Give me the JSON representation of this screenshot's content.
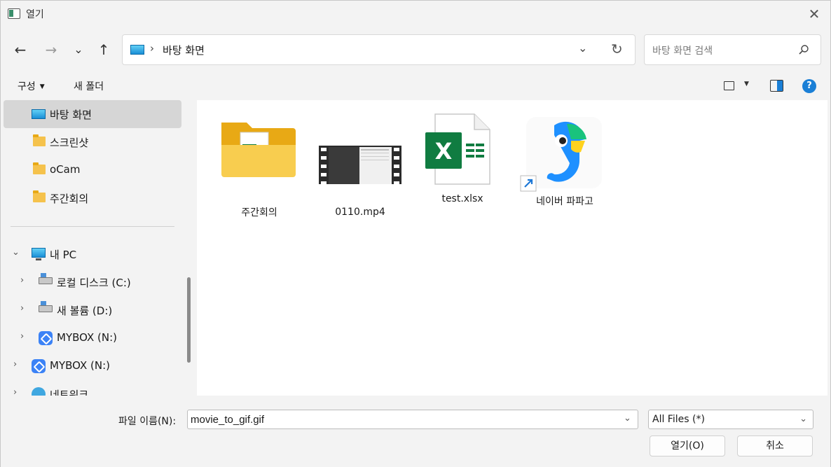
{
  "window": {
    "title": "열기"
  },
  "nav": {
    "back": "←",
    "forward": "→",
    "recent": "⌄",
    "up": "↑"
  },
  "address": {
    "separator": "›",
    "path": "바탕 화면",
    "dropdown": "⌄",
    "refresh": "↻"
  },
  "search": {
    "placeholder": "바탕 화면 검색"
  },
  "toolbar": {
    "organize": "구성",
    "new_folder": "새 폴더",
    "help": "?"
  },
  "sidebar": {
    "items": [
      {
        "label": "바탕 화면"
      },
      {
        "label": "스크린샷"
      },
      {
        "label": "oCam"
      },
      {
        "label": "주간회의"
      },
      {
        "label": "내 PC"
      },
      {
        "label": "로컬 디스크 (C:)"
      },
      {
        "label": "새 볼륨 (D:)"
      },
      {
        "label": "MYBOX (N:)"
      },
      {
        "label": "MYBOX (N:)"
      },
      {
        "label": "네트워크"
      }
    ]
  },
  "files": [
    {
      "name": "주간회의",
      "icon": "folder-excel-icon"
    },
    {
      "name": "0110.mp4",
      "icon": "video-icon"
    },
    {
      "name": "test.xlsx",
      "icon": "excel-icon"
    },
    {
      "name": "네이버 파파고",
      "icon": "papago-shortcut-icon"
    }
  ],
  "bottom": {
    "filename_label": "파일 이름(N):",
    "filename_value": "movie_to_gif.gif",
    "filetype": "All Files (*)",
    "open_button": "열기(O)",
    "cancel_button": "취소"
  },
  "colors": {
    "accent": "#1a7fd6",
    "selected": "#d6d6d6",
    "excel": "#107c41"
  }
}
